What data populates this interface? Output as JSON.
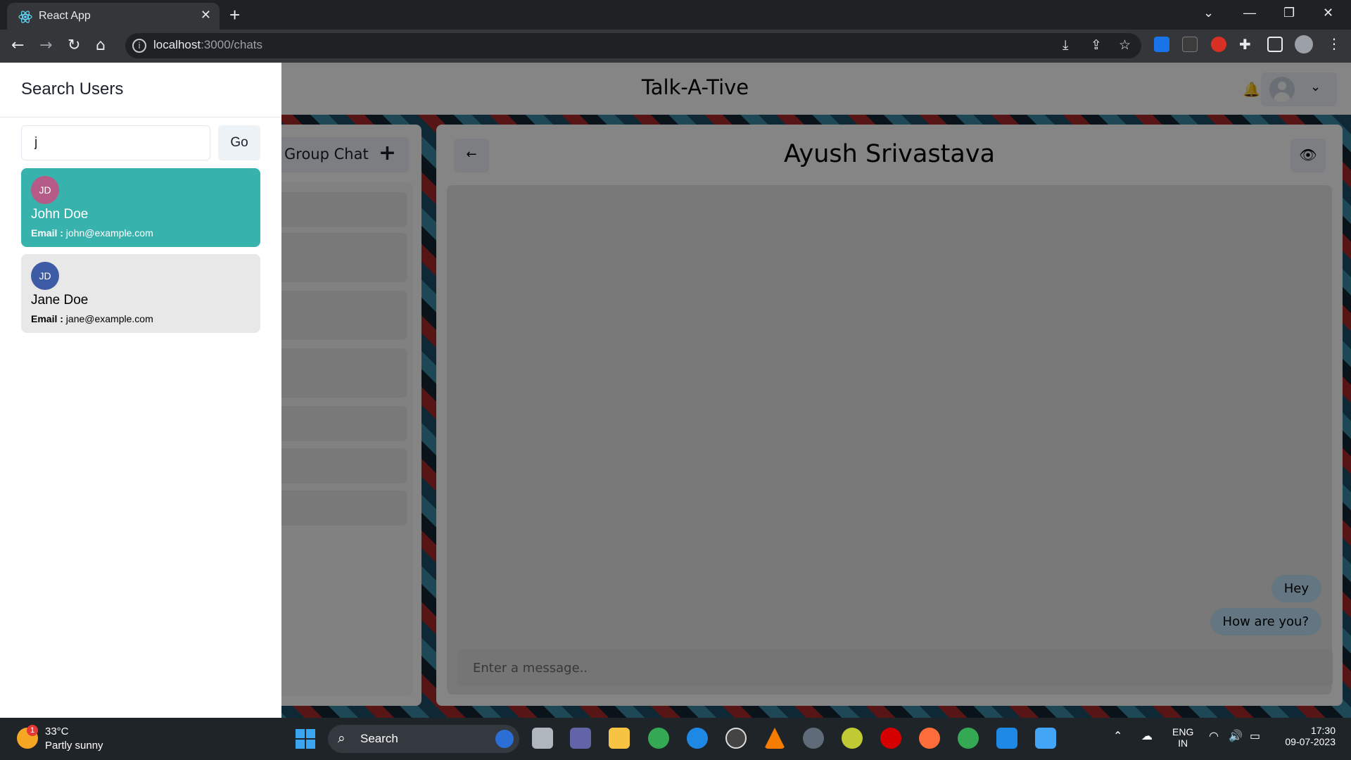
{
  "browser": {
    "tab_title": "React App",
    "tab_close": "✕",
    "new_tab": "+",
    "url_host": "localhost",
    "url_path": ":3000/chats",
    "window_controls": [
      "⌄",
      "—",
      "❐",
      "✕"
    ]
  },
  "app": {
    "title": "Talk-A-Tive",
    "bell_icon": "bell-icon",
    "profile_chevron": "⌄"
  },
  "my_chats": {
    "new_group_label": "Group Chat",
    "new_group_icon": "+"
  },
  "chat": {
    "name": "Ayush Srivastava",
    "back_icon": "←",
    "view_icon": "👁",
    "messages": [
      {
        "text": "Hey"
      },
      {
        "text": "How are you?"
      }
    ],
    "input_placeholder": "Enter a message.."
  },
  "drawer": {
    "title": "Search Users",
    "search_value": "j",
    "go_label": "Go",
    "email_prefix": "Email :",
    "users": [
      {
        "initials": "JD",
        "name": "John Doe",
        "email": "john@example.com",
        "avatar_color": "#b65b87",
        "selected": true
      },
      {
        "initials": "JD",
        "name": "Jane Doe",
        "email": "jane@example.com",
        "avatar_color": "#3e5ba6",
        "selected": false
      }
    ]
  },
  "colors": {
    "accent": "#38b2ac",
    "bubble": "#bee3f8"
  },
  "taskbar": {
    "weather_badge": "1",
    "temperature": "33°C",
    "weather": "Partly sunny",
    "search_label": "Search",
    "lang_top": "ENG",
    "lang_bottom": "IN",
    "time": "17:30",
    "date": "09-07-2023"
  }
}
